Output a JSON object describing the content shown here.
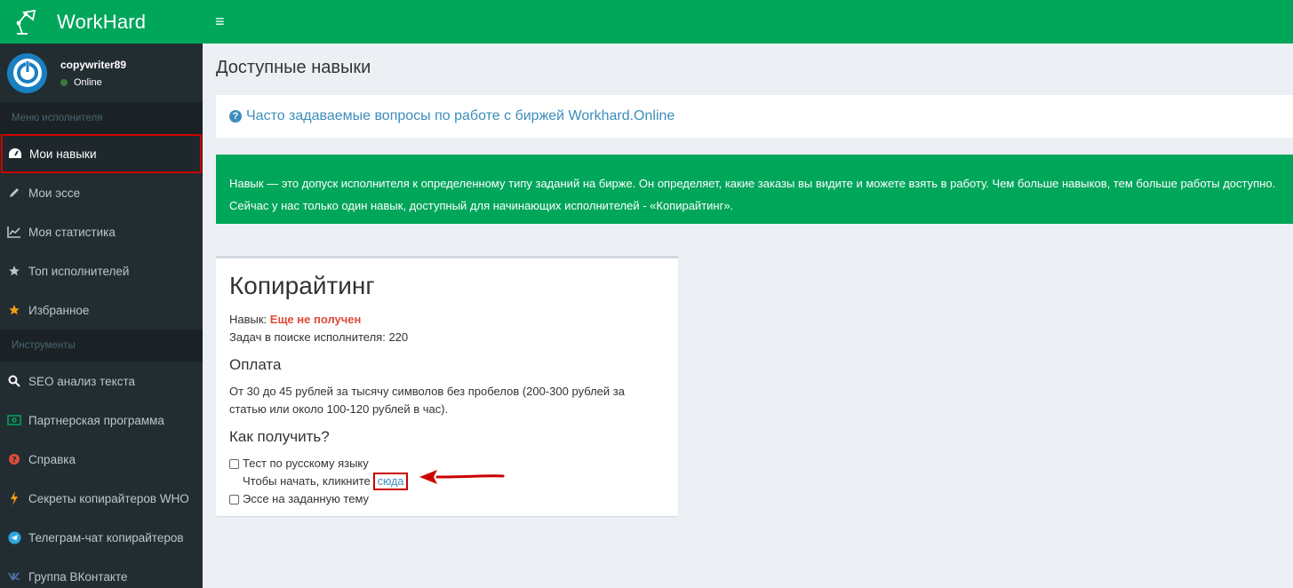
{
  "app": {
    "name": "WorkHard",
    "brand_color": "#00a65a",
    "sidebar_color": "#222d32"
  },
  "user": {
    "name": "copywriter89",
    "status": "Online"
  },
  "sidebar": {
    "section1": "Меню исполнителя",
    "menu1": [
      {
        "label": "Мои навыки",
        "icon": "dashboard-icon",
        "active": true
      },
      {
        "label": "Мои эссе",
        "icon": "pencil-icon"
      },
      {
        "label": "Моя статистика",
        "icon": "line-chart-icon"
      },
      {
        "label": "Топ исполнителей",
        "icon": "star-icon"
      },
      {
        "label": "Избранное",
        "icon": "star-icon"
      }
    ],
    "section2": "Инструменты",
    "menu2": [
      {
        "label": "SEO анализ текста",
        "icon": "search-icon"
      },
      {
        "label": "Партнерская программа",
        "icon": "money-icon"
      },
      {
        "label": "Справка",
        "icon": "help-icon"
      },
      {
        "label": "Секреты копирайтеров WHO",
        "icon": "bolt-icon"
      },
      {
        "label": "Телеграм-чат копирайтеров",
        "icon": "telegram-icon"
      },
      {
        "label": "Группа ВКонтакте",
        "icon": "vk-icon"
      }
    ]
  },
  "page": {
    "title": "Доступные навыки",
    "faq_link": "Часто задаваемые вопросы по работе с биржей Workhard.Online",
    "info_line1": "Навык — это допуск исполнителя к определенному типу заданий на бирже. Он определяет, какие заказы вы видите и можете взять в работу. Чем больше навыков, тем больше работы доступно.",
    "info_line2": "Сейчас у нас только один навык, доступный для начинающих исполнителей - «Копирайтинг»."
  },
  "skill": {
    "title": "Копирайтинг",
    "status_label": "Навык:",
    "status_value": "Еще не получен",
    "tasks_text": "Задач в поиске исполнителя: 220",
    "payment_title": "Оплата",
    "payment_text": "От 30 до 45 рублей за тысячу символов без пробелов (200-300 рублей за статью или около 100-120 рублей в час).",
    "how_title": "Как получить?",
    "test_label": "Тест по русскому языку",
    "start_text": "Чтобы начать, кликните",
    "start_link": "сюда",
    "essay_label": "Эссе на заданную тему"
  }
}
